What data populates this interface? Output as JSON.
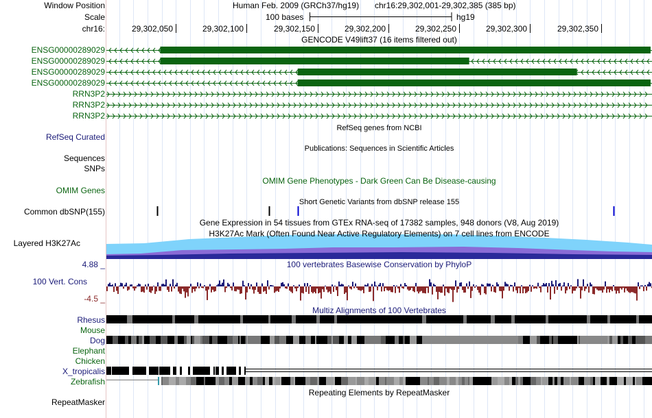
{
  "header": {
    "label_position": "Window Position",
    "label_scale": "Scale",
    "label_chrom": "chr16:",
    "assembly": "Human Feb. 2009 (GRCh37/hg19)",
    "coords": "chr16:29,302,001-29,302,385 (385 bp)",
    "scale_text": "100 bases",
    "scale_db": "hg19"
  },
  "ruler": {
    "start": 29302001,
    "end": 29302385,
    "ticks": [
      {
        "pos": 29302050,
        "label": "29,302,050"
      },
      {
        "pos": 29302100,
        "label": "29,302,100"
      },
      {
        "pos": 29302150,
        "label": "29,302,150"
      },
      {
        "pos": 29302200,
        "label": "29,302,200"
      },
      {
        "pos": 29302250,
        "label": "29,302,250"
      },
      {
        "pos": 29302300,
        "label": "29,302,300"
      },
      {
        "pos": 29302350,
        "label": "29,302,350"
      }
    ]
  },
  "gencode": {
    "title": "GENCODE V49lift37 (16 items filtered out)",
    "items": [
      {
        "label": "ENSG00000289029",
        "name": "ENSG00000289029",
        "thick_start": 29302039,
        "thick_end": 29302385,
        "color": "#0a6410"
      },
      {
        "label": "ENSG00000289029",
        "name": "ENSG00000289029",
        "thick_start": 29302039,
        "thick_end": 29302257,
        "color": "#0a6410"
      },
      {
        "label": "ENSG00000289029",
        "name": "ENSG00000289029",
        "thick_start": 29302136,
        "thick_end": 29302333,
        "color": "#0a6410"
      },
      {
        "label": "ENSG00000289029",
        "name": "ENSG00000289029",
        "thick_start": 29302136,
        "thick_end": 29302385,
        "color": "#0a6410"
      },
      {
        "label": "RRN3P2",
        "name": "RRN3P2",
        "thick_start": null,
        "thick_end": null,
        "color": "#0a6410"
      },
      {
        "label": "RRN3P2",
        "name": "RRN3P2",
        "thick_start": null,
        "thick_end": null,
        "color": "#0a6410"
      },
      {
        "label": "RRN3P2",
        "name": "RRN3P2",
        "thick_start": null,
        "thick_end": null,
        "color": "#0a6410"
      }
    ]
  },
  "tracks": {
    "refseq_title": "RefSeq genes from NCBI",
    "refseq_label": "RefSeq Curated",
    "pubs_title": "Publications: Sequences in Scientific Articles",
    "seq_label": "Sequences",
    "snps_label": "SNPs",
    "omim_title": "OMIM Gene Phenotypes - Dark Green Can Be Disease-causing",
    "omim_label": "OMIM Genes",
    "dbsnp_title": "Short Genetic Variants from dbSNP release 155",
    "dbsnp_label": "Common dbSNP(155)",
    "gtex_title": "Gene Expression in 54 tissues from GTEx RNA-seq of 17382 samples, 948 donors (V8, Aug 2019)",
    "h3k27_title": "H3K27Ac Mark (Often Found Near Active Regulatory Elements) on 7 cell lines from ENCODE",
    "h3k27_label": "Layered H3K27Ac",
    "cons_title": "100 vertebrates Basewise Conservation by PhyloP",
    "cons_label": "100 Vert. Cons",
    "cons_max": "4.88 _",
    "cons_min": "-4.5 _",
    "multiz_title": "Multiz Alignments of 100 Vertebrates",
    "rmsk_title": "Repeating Elements by RepeatMasker",
    "rmsk_label": "RepeatMasker"
  },
  "dbsnp_positions": [
    {
      "pos": 29302037,
      "color": "#000000"
    },
    {
      "pos": 29302116,
      "color": "#000000"
    },
    {
      "pos": 29302136,
      "color": "#0000d0"
    },
    {
      "pos": 29302359,
      "color": "#0000d0"
    }
  ],
  "species": [
    {
      "name": "Rhesus",
      "color": "#1a1a78"
    },
    {
      "name": "Mouse",
      "color": "#0a6410"
    },
    {
      "name": "Dog",
      "color": "#1a1a78"
    },
    {
      "name": "Elephant",
      "color": "#0a6410"
    },
    {
      "name": "Chicken",
      "color": "#0a6410"
    },
    {
      "name": "X_tropicalis",
      "color": "#1a1a78"
    },
    {
      "name": "Zebrafish",
      "color": "#0a6410"
    }
  ],
  "colors": {
    "gene": "#0a6410",
    "label_blue": "#1a1a78",
    "cons_pos": "#1a1a78",
    "cons_neg": "#8b2a2a",
    "h3k27_light": "#7fd3fb",
    "h3k27_dark": "#2a2a9a",
    "gridline": "#dde6f6"
  }
}
